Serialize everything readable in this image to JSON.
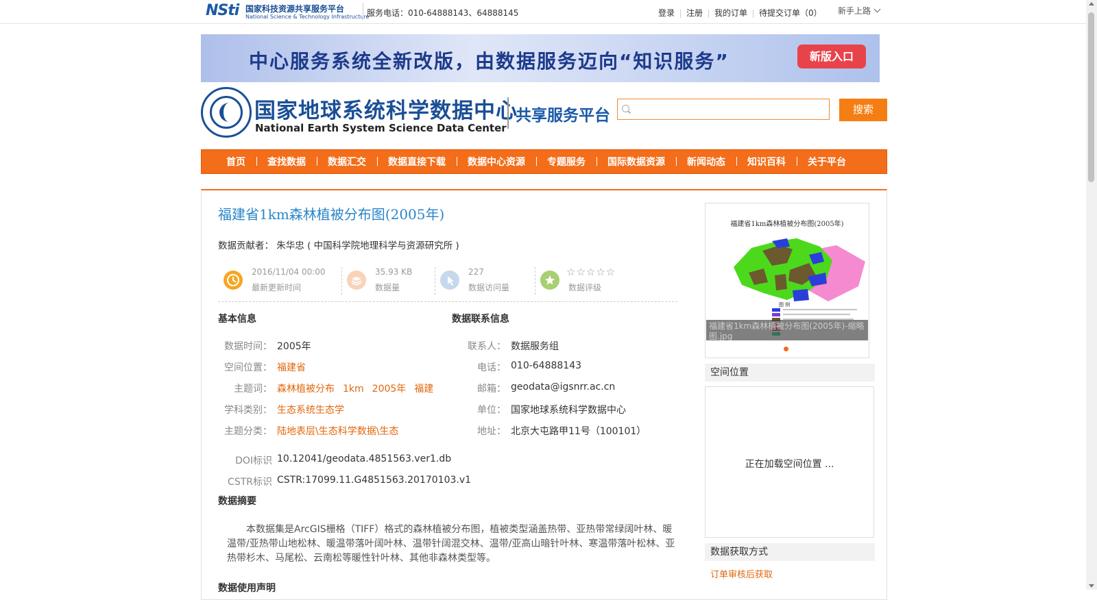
{
  "topbar": {
    "logo_mark": "NSti",
    "logo_cn": "国家科技资源共享服务平台",
    "logo_en": "National Science & Technology Infrastructure",
    "service_phone": "服务电话：010-64888143、64888145",
    "links": [
      "登录",
      "注册",
      "我的订单",
      "待提交订单（0）"
    ],
    "guide": "新手上路"
  },
  "banner": {
    "text": "中心服务系统全新改版，由数据服务迈向“知识服务”",
    "button": "新版入口"
  },
  "header": {
    "logo_cn": "国家地球系统科学数据中心",
    "logo_en": "National Earth System Science Data Center",
    "platform": "共享服务平台",
    "search_placeholder": "",
    "search_button": "搜索"
  },
  "nav": [
    "首页",
    "查找数据",
    "数据汇交",
    "数据直接下载",
    "数据中心资源",
    "专题服务",
    "国际数据资源",
    "新闻动态",
    "知识百科",
    "关于平台"
  ],
  "dataset": {
    "title": "福建省1km森林植被分布图(2005年)",
    "contributor": "数据贡献者： 朱华忠 ( 中国科学院地理科学与资源研究所 )",
    "stats": {
      "updated_value": "2016/11/04 00:00",
      "updated_label": "最新更新时间",
      "size_value": "35.93 KB",
      "size_label": "数据量",
      "visits_value": "227",
      "visits_label": "数据访问量",
      "rating_stars": "☆☆☆☆☆",
      "rating_label": "数据评级"
    },
    "basic_info": {
      "heading": "基本信息",
      "time_label": "数据时间：",
      "time_value": "2005年",
      "location_label": "空间位置：",
      "location_value": "福建省",
      "keywords_label": "主题词：",
      "keywords": [
        "森林植被分布",
        "1km",
        "2005年",
        "福建"
      ],
      "discipline_label": "学科类别：",
      "discipline_value": "生态系统生态学",
      "category_label": "主题分类：",
      "category_value": "陆地表层\\生态科学数据\\生态",
      "doi_label": "DOI标识",
      "doi_value": "10.12041/geodata.4851563.ver1.db",
      "cstr_label": "CSTR标识",
      "cstr_value": "CSTR:17099.11.G4851563.20170103.v1"
    },
    "contact_info": {
      "heading": "数据联系信息",
      "contact_label": "联系人：",
      "contact_value": "数据服务组",
      "phone_label": "电话：",
      "phone_value": "010-64888143",
      "email_label": "邮箱：",
      "email_value": "geodata@igsnrr.ac.cn",
      "unit_label": "单位：",
      "unit_value": "国家地球系统科学数据中心",
      "address_label": "地址：",
      "address_value": "北京大屯路甲11号（100101）"
    },
    "abstract_heading": "数据摘要",
    "abstract": "本数据集是ArcGIS栅格（TIFF）格式的森林植被分布图，植被类型涵盖热带、亚热带常绿阔叶林、暖温带/亚热带山地松林、暖温带落叶阔叶林、温带针阔混交林、温带/亚高山暗针叶林、寒温带落叶松林、亚热带杉木、马尾松、云南松等暖性针叶林、其他非森林类型等。",
    "usage_heading": "数据使用声明"
  },
  "sidebar": {
    "thumb_title": "福建省1km森林植被分布图(2005年)",
    "thumb_legend": "图 例",
    "thumb_caption": "福建省1km森林植被分布图(2005年)-缩略图.jpg",
    "spatial_heading": "空间位置",
    "spatial_loading": "正在加载空间位置 ...",
    "access_heading": "数据获取方式",
    "access_link": "订单审核后获取"
  },
  "colors": {
    "accent": "#f36d1a",
    "link": "#2a86c9",
    "tag": "#e2670c"
  }
}
